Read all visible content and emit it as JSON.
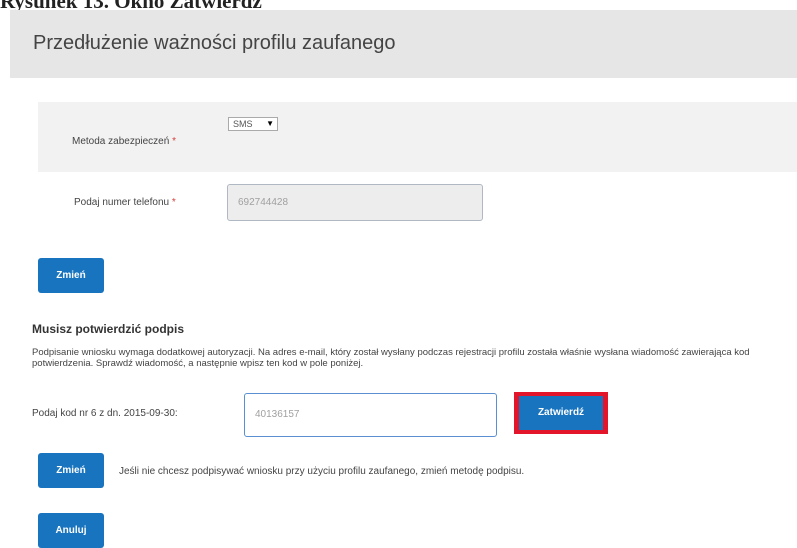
{
  "caption": "Rysunek 13. Okno Zatwierdź",
  "header": {
    "title": "Przedłużenie ważności profilu zaufanego"
  },
  "security_method": {
    "label": "Metoda zabezpieczeń",
    "required_mark": "*",
    "selected_value": "SMS",
    "arrow": "▼"
  },
  "phone": {
    "label": "Podaj numer telefonu",
    "required_mark": "*",
    "value": "692744428"
  },
  "buttons": {
    "change_1": "Zmień",
    "confirm": "Zatwierdź",
    "change_2": "Zmień",
    "cancel": "Anuluj"
  },
  "signature": {
    "title": "Musisz potwierdzić podpis",
    "description": "Podpisanie wniosku wymaga dodatkowej autoryzacji. Na adres e-mail, który został wysłany podczas rejestracji profilu została właśnie wysłana wiadomość zawierająca kod potwierdzenia. Sprawdź wiadomość, a następnie wpisz ten kod w pole poniżej.",
    "code_label": "Podaj kod nr 6 z dn. 2015-09-30:",
    "code_value": "40136157",
    "change_method_note": "Jeśli nie chcesz podpisywać wniosku przy użyciu profilu zaufanego, zmień metodę podpisu."
  },
  "colors": {
    "primary_button": "#1874be",
    "highlight": "#e3152a",
    "header_bg": "#e6e6e6"
  }
}
